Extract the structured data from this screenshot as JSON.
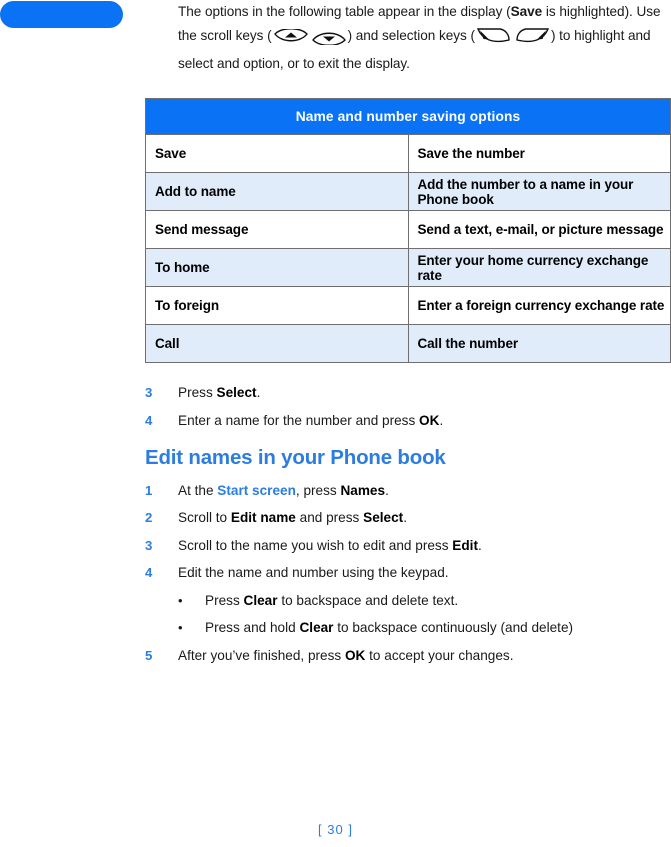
{
  "corner_tab": {
    "color": "#0a72f5",
    "label": ""
  },
  "intro": {
    "part1": "The options in the following table appear in the display (",
    "bold1": "Save",
    "part2": " is highlighted). Use the scroll keys (",
    "icon_scroll_up": "scroll-up-key-icon",
    "icon_scroll_down": "scroll-down-key-icon",
    "part3": ") and selection keys (",
    "icon_softkey_left": "left-selection-key-icon",
    "icon_softkey_right": "right-selection-key-icon",
    "part4": ") to highlight and select and option, or to exit the display."
  },
  "table": {
    "header": "Name and number saving options",
    "rows": [
      {
        "option": "Save",
        "description": "Save the number"
      },
      {
        "option": "Add to name",
        "description": "Add the number to a name in your Phone book"
      },
      {
        "option": "Send message",
        "description": "Send a text, e-mail, or picture message"
      },
      {
        "option": "To home",
        "description": "Enter your home currency exchange rate"
      },
      {
        "option": "To foreign",
        "description": "Enter a foreign currency exchange rate"
      },
      {
        "option": "Call",
        "description": "Call the number"
      }
    ]
  },
  "steps_top": [
    {
      "num": "3",
      "t1": "Press ",
      "b1": "Select",
      "t2": "."
    },
    {
      "num": "4",
      "t1": "Enter a name for the number and press ",
      "b1": "OK",
      "t2": "."
    }
  ],
  "section_heading": "Edit names in your Phone book",
  "steps_bottom": [
    {
      "num": "1",
      "t1": "At the ",
      "link": "Start screen",
      "t2": ", press ",
      "b1": "Names",
      "t3": "."
    },
    {
      "num": "2",
      "t1": "Scroll to ",
      "b1": "Edit name",
      "t2": " and press ",
      "b2": "Select",
      "t3": "."
    },
    {
      "num": "3",
      "t1": "Scroll to the name you wish to edit and press ",
      "b1": "Edit",
      "t2": "."
    },
    {
      "num": "4",
      "t1": "Edit the name and number using the keypad.",
      "b1": "",
      "t2": ""
    }
  ],
  "bullets": [
    {
      "marker": "•",
      "t1": "Press ",
      "b1": "Clear",
      "t2": " to backspace and delete text."
    },
    {
      "marker": "•",
      "t1": "Press and hold ",
      "b1": "Clear",
      "t2": " to backspace continuously (and delete)"
    }
  ],
  "step_final": {
    "num": "5",
    "t1": "After you’ve finished, press ",
    "b1": "OK",
    "t2": " to accept your changes."
  },
  "footer": {
    "page": "[ 30 ]"
  },
  "colors": {
    "accent_blue": "#2b7de0",
    "header_blue": "#0a72f5",
    "row_tint": "#e1ecfa",
    "border": "#6f6f6f"
  }
}
